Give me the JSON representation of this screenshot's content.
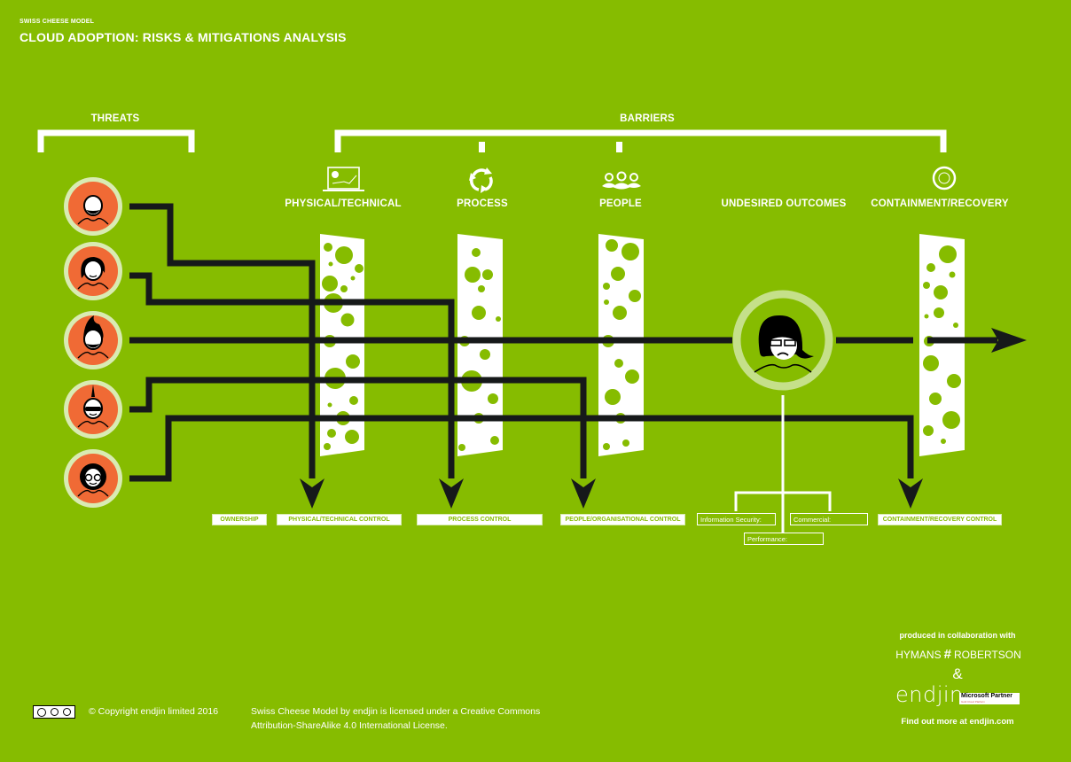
{
  "header": {
    "subtitle": "SWISS CHEESE MODEL",
    "title": "CLOUD ADOPTION: RISKS & MITIGATIONS ANALYSIS"
  },
  "sections": {
    "threats": "THREATS",
    "barriers": "BARRIERS"
  },
  "columns": [
    {
      "label": "PHYSICAL/TECHNICAL",
      "icon": "laptop-chart-icon"
    },
    {
      "label": "PROCESS",
      "icon": "cycle-arrows-icon"
    },
    {
      "label": "PEOPLE",
      "icon": "people-group-icon"
    },
    {
      "label": "UNDESIRED OUTCOMES",
      "icon": ""
    },
    {
      "label": "CONTAINMENT/RECOVERY",
      "icon": "target-ring-icon"
    }
  ],
  "threats": [
    {
      "name": "bald-bearded-person"
    },
    {
      "name": "long-haired-person"
    },
    {
      "name": "spiky-haired-bearded-person"
    },
    {
      "name": "mohawk-sunglasses-person"
    },
    {
      "name": "afro-glasses-person"
    }
  ],
  "controls": {
    "ownership": "OWNERSHIP",
    "physical": "PHYSICAL/TECHNICAL CONTROL",
    "process": "PROCESS CONTROL",
    "people": "PEOPLE/ORGANISATIONAL CONTROL",
    "containment": "CONTAINMENT/RECOVERY CONTROL"
  },
  "outcomes": {
    "info_security": "Information Security:",
    "commercial": "Commercial:",
    "performance": "Performance:"
  },
  "colors": {
    "background": "#86bc00",
    "threat": "#f06a35",
    "threat_ring": "#d9ebb3",
    "path": "#16191a",
    "outcome_ring": "#c5e08a"
  },
  "footer": {
    "cc_badge": "cc by sa",
    "copyright": "© Copyright endjin limited 2016",
    "license_line1": "Swiss Cheese Model by endjin is licensed under a Creative Commons",
    "license_line2": "Attribution-ShareAlike 4.0 International License.",
    "collab": "produced in collaboration with",
    "partner1_left": "HYMANS",
    "partner1_mark": "#",
    "partner1_right": "ROBERTSON",
    "amp": "&",
    "partner2": "endjin",
    "ms_partner": "Microsoft Partner",
    "ms_sub": "Gold Cloud Platform",
    "more": "Find out more at endjin.com"
  }
}
